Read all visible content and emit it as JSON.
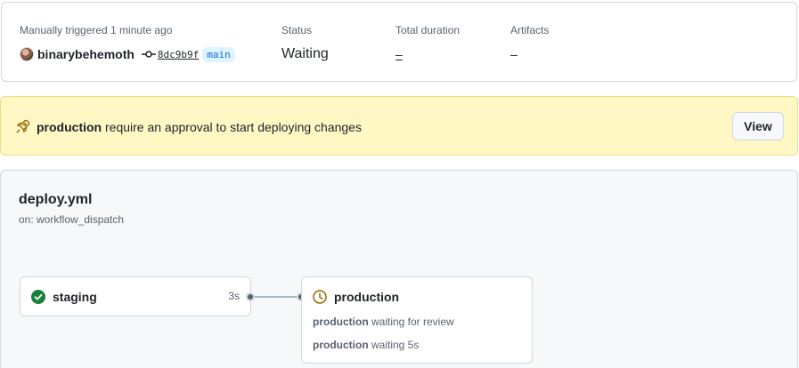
{
  "summary": {
    "trigger_label": "Manually triggered 1 minute ago",
    "actor": "binarybehemoth",
    "commit_sha": "8dc9b9f",
    "branch": "main",
    "status_label": "Status",
    "status_value": "Waiting",
    "duration_label": "Total duration",
    "duration_value": "–",
    "artifacts_label": "Artifacts",
    "artifacts_value": "–"
  },
  "banner": {
    "environment": "production",
    "message": " require an approval to start deploying changes",
    "view_label": "View",
    "background": "#fff8c5",
    "icon": "rocket-icon"
  },
  "workflow": {
    "file": "deploy.yml",
    "trigger": "on: workflow_dispatch",
    "jobs": [
      {
        "name": "staging",
        "duration": "3s",
        "state": "success",
        "icon": "check-circle-icon"
      },
      {
        "name": "production",
        "state": "waiting",
        "icon": "clock-icon",
        "lines": [
          {
            "env": "production",
            "text": " waiting for review"
          },
          {
            "env": "production",
            "text": " waiting 5s"
          }
        ]
      }
    ]
  },
  "colors": {
    "success": "#1a7f37",
    "waiting": "#9a6700",
    "link": "#0969da",
    "muted": "#59636e"
  }
}
